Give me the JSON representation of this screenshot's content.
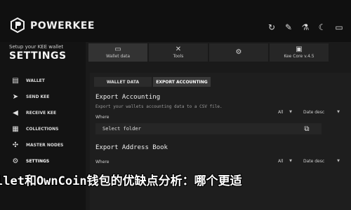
{
  "header": {
    "brand": "POWERKEE",
    "icons": [
      "refresh-icon",
      "pin-icon",
      "flask-icon",
      "moon-icon",
      "window-icon"
    ]
  },
  "sidebar": {
    "subtitle": "Setup your KEE wallet",
    "title": "SETTINGS",
    "items": [
      {
        "label": "WALLET",
        "icon": "wallet-icon"
      },
      {
        "label": "SEND KEE",
        "icon": "send-icon"
      },
      {
        "label": "RECEIVE KEE",
        "icon": "receive-icon"
      },
      {
        "label": "COLLECTIONS",
        "icon": "collections-icon"
      },
      {
        "label": "MASTER NODES",
        "icon": "masternodes-icon"
      },
      {
        "label": "SETTINGS",
        "icon": "settings-icon"
      }
    ]
  },
  "top_tabs": [
    {
      "label": "Wallet data",
      "icon": "folder-icon"
    },
    {
      "label": "Tools",
      "icon": "tools-icon"
    },
    {
      "label": "",
      "icon": "gear-icon"
    },
    {
      "label": "Kee Core v.4.5",
      "icon": "info-icon"
    }
  ],
  "sub_tabs": [
    "WALLET DATA",
    "EXPORT ACCOUNTING"
  ],
  "export_accounting": {
    "title": "Export Accounting",
    "desc": "Export your wallets accounting data to a CSV file.",
    "where_label": "Where",
    "filter_value": "All",
    "sort_value": "Date desc",
    "folder_placeholder": "Select folder"
  },
  "export_address_book": {
    "title": "Export Address Book",
    "where_label": "Where",
    "filter_value": "All",
    "sort_value": "Date desc"
  },
  "overlay_text": "llet和OwnCoin钱包的优缺点分析：哪个更适"
}
